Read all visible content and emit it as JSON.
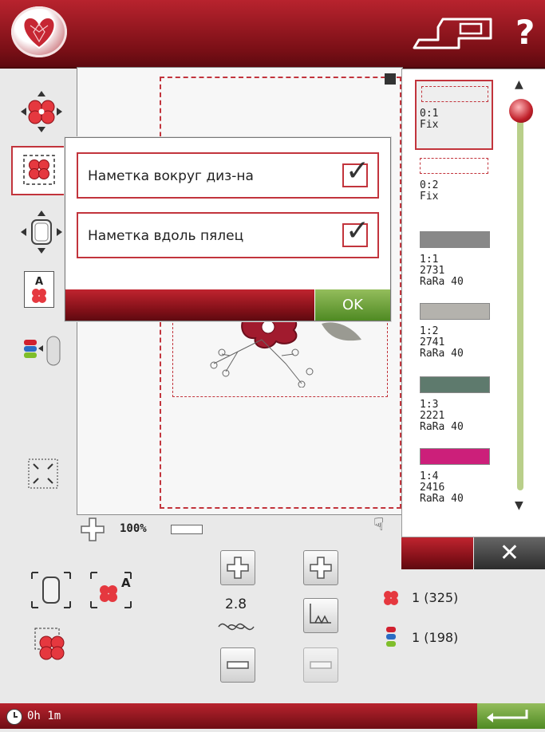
{
  "topbar": {
    "logo_icon": "heart-logo-icon",
    "machine_icon": "sewing-machine-icon",
    "help_label": "?"
  },
  "left_toolbar": [
    {
      "name": "move-design-icon"
    },
    {
      "name": "basting-icon"
    },
    {
      "name": "move-hoop-icon"
    },
    {
      "name": "text-in-design-icon"
    },
    {
      "name": "color-sort-icon"
    },
    {
      "name": "corner-check-icon"
    }
  ],
  "zoom": {
    "value": "100%"
  },
  "dialog": {
    "options": [
      {
        "label": "Наметка вокруг диз-на",
        "checked": true
      },
      {
        "label": "Наметка вдоль пялец",
        "checked": true
      }
    ],
    "ok_label": "OK"
  },
  "color_list": {
    "items": [
      {
        "line1": "0:1",
        "line2": "Fix",
        "line3": "",
        "color": "",
        "selected": true
      },
      {
        "line1": "0:2",
        "line2": "Fix",
        "line3": "",
        "color": ""
      },
      {
        "line1": "1:1",
        "line2": "2731",
        "line3": "RaRa 40",
        "color": "#888888"
      },
      {
        "line1": "1:2",
        "line2": "2741",
        "line3": "RaRa 40",
        "color": "#b4b2ad"
      },
      {
        "line1": "1:3",
        "line2": "2221",
        "line3": "RaRa 40",
        "color": "#5e7a6d"
      },
      {
        "line1": "1:4",
        "line2": "2416",
        "line3": "RaRa 40",
        "color": "#cc1f7a"
      }
    ]
  },
  "bottom": {
    "stitch_width": "2.8",
    "designs_count": "1 (325)",
    "colors_count": "1 (198)"
  },
  "status": {
    "time": "0h 1m"
  },
  "colors": {
    "accent": "#c2343c",
    "green": "#5c9a2c"
  }
}
